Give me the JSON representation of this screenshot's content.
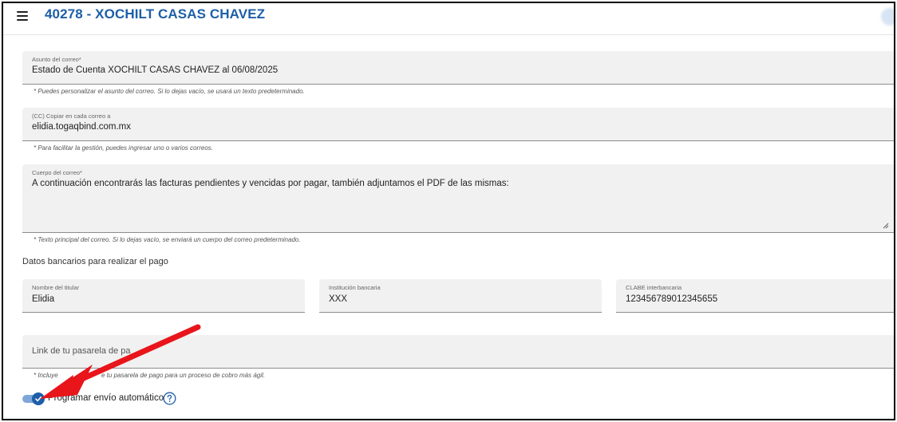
{
  "header": {
    "title": "40278 - XOCHILT CASAS CHAVEZ",
    "menu_icon": "hamburger-menu-icon"
  },
  "subject": {
    "label": "Asunto del correo*",
    "value": "Estado de Cuenta XOCHILT CASAS CHAVEZ al 06/08/2025",
    "hint": "* Puedes personalizar el asunto del correo. Si lo dejas vacío, se usará un texto predeterminado."
  },
  "cc": {
    "label": "(CC) Copiar en cada correo a",
    "value": "elidia.togaqbind.com.mx",
    "hint": "* Para facilitar la gestión, puedes ingresar uno o varios correos."
  },
  "body": {
    "label": "Cuerpo del correo*",
    "value": "A continuación encontrarás las facturas pendientes y vencidas por pagar, también adjuntamos el PDF de las mismas:",
    "hint": "* Texto principal del correo. Si lo dejas vacío, se enviará un cuerpo del correo predeterminado."
  },
  "bank": {
    "section_title": "Datos bancarios para realizar el pago",
    "holder_label": "Nombre del titular",
    "holder_value": "Elidia",
    "institution_label": "Institución bancaria",
    "institution_value": "XXX",
    "clabe_label": "CLABE interbancaria",
    "clabe_value": "123456789012345655"
  },
  "payment_link": {
    "placeholder": "Link de tu pasarela de pa",
    "hint_start": "* Incluye",
    "hint_end": "e tu pasarela de pago para un proceso de cobro más ágil."
  },
  "auto_send": {
    "label": "Programar envío automático",
    "checked": true,
    "help_icon": "question-circle-icon"
  },
  "colors": {
    "accent": "#1d5fa8",
    "annotation_arrow": "#e8151b"
  }
}
